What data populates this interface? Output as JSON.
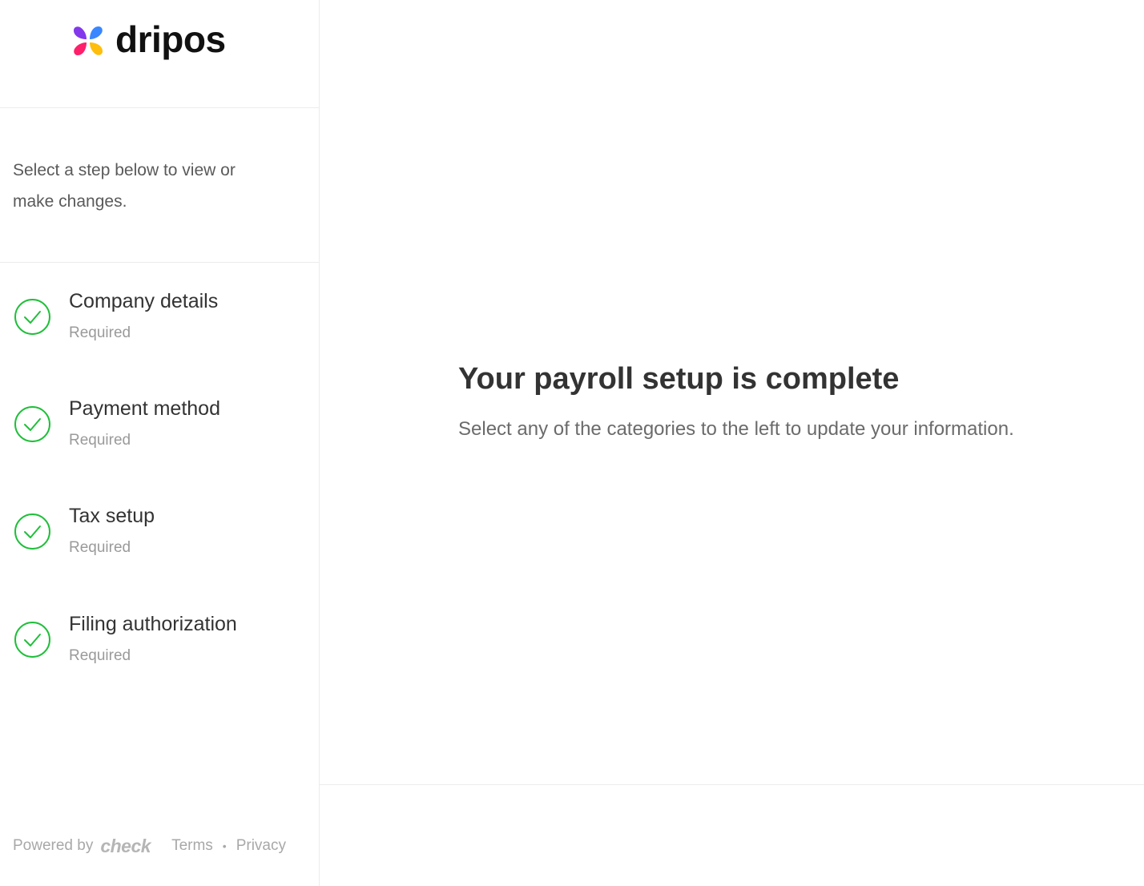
{
  "brand": {
    "name": "dripos",
    "logo_colors": [
      "#3a86ff",
      "#ff1f6b",
      "#ffbe0b",
      "#8338ec"
    ]
  },
  "sidebar": {
    "intro": "Select a step below to view or make changes.",
    "steps": [
      {
        "title": "Company details",
        "status": "Required",
        "icon": "check-circle-icon"
      },
      {
        "title": "Payment method",
        "status": "Required",
        "icon": "check-circle-icon"
      },
      {
        "title": "Tax setup",
        "status": "Required",
        "icon": "check-circle-icon"
      },
      {
        "title": "Filing authorization",
        "status": "Required",
        "icon": "check-circle-icon"
      }
    ],
    "check_color": "#1fbf3a"
  },
  "footer": {
    "powered_by": "Powered by",
    "provider": "check",
    "terms": "Terms",
    "separator": "•",
    "privacy": "Privacy"
  },
  "main": {
    "title": "Your payroll setup is complete",
    "subtitle": "Select any of the categories to the left to update your information."
  }
}
